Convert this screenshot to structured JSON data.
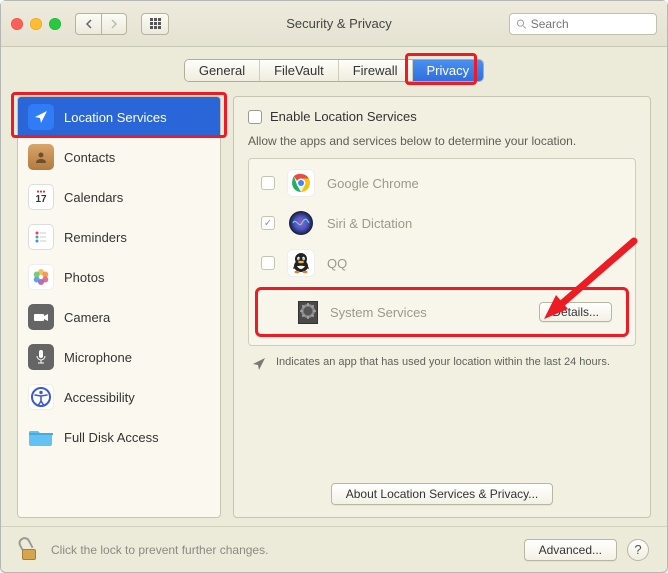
{
  "window": {
    "title": "Security & Privacy"
  },
  "search": {
    "placeholder": "Search"
  },
  "tabs": [
    "General",
    "FileVault",
    "Firewall",
    "Privacy"
  ],
  "active_tab": "Privacy",
  "sidebar": {
    "items": [
      {
        "label": "Location Services",
        "icon": "location-arrow",
        "selected": true,
        "icon_bg": "#2f7cf6",
        "icon_fg": "#fff"
      },
      {
        "label": "Contacts",
        "icon": "contacts",
        "icon_bg": "#c38a4a"
      },
      {
        "label": "Calendars",
        "icon": "calendar",
        "icon_bg": "#fff"
      },
      {
        "label": "Reminders",
        "icon": "reminders",
        "icon_bg": "#fff"
      },
      {
        "label": "Photos",
        "icon": "photos",
        "icon_bg": "#fff"
      },
      {
        "label": "Camera",
        "icon": "camera",
        "icon_bg": "#656565"
      },
      {
        "label": "Microphone",
        "icon": "microphone",
        "icon_bg": "#656565"
      },
      {
        "label": "Accessibility",
        "icon": "accessibility",
        "icon_bg": "#3b58d6"
      },
      {
        "label": "Full Disk Access",
        "icon": "folder",
        "icon_bg": "#4fb4ef"
      }
    ]
  },
  "panel": {
    "enable_label": "Enable Location Services",
    "enable_checked": false,
    "description": "Allow the apps and services below to determine your location.",
    "apps": [
      {
        "name": "Google Chrome",
        "checked": false
      },
      {
        "name": "Siri & Dictation",
        "checked": true
      },
      {
        "name": "QQ",
        "checked": false
      }
    ],
    "system_services_label": "System Services",
    "details_button": "Details...",
    "indicator_text": "Indicates an app that has used your location within the last 24 hours.",
    "about_button": "About Location Services & Privacy..."
  },
  "footer": {
    "lock_text": "Click the lock to prevent further changes.",
    "advanced_button": "Advanced..."
  },
  "highlights": {
    "tab_privacy": true,
    "sidebar_location": true,
    "system_services": true
  }
}
